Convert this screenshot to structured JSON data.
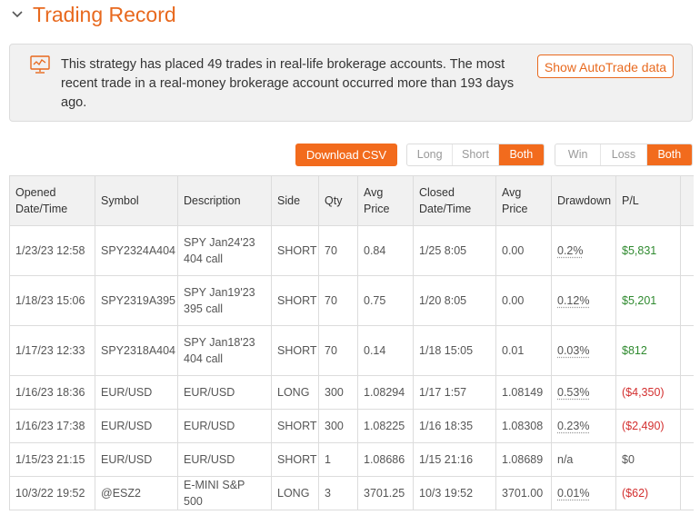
{
  "section": {
    "title": "Trading Record"
  },
  "notice": {
    "icon": "chart-monitor-icon",
    "text": "This strategy has placed 49 trades in real-life brokerage accounts. The most recent trade in a real-money brokerage account occurred more than 193 days ago.",
    "button_label": "Show AutoTrade data"
  },
  "toolbar": {
    "csv_label": "Download CSV",
    "direction_options": [
      "Long",
      "Short",
      "Both"
    ],
    "direction_selected": "Both",
    "outcome_options": [
      "Win",
      "Loss",
      "Both"
    ],
    "outcome_selected": "Both"
  },
  "table": {
    "headers": [
      "Opened\nDate/Time",
      "Symbol",
      "Description",
      "Side",
      "Qty",
      "Avg\nPrice",
      "Closed\nDate/Time",
      "Avg\nPrice",
      "Drawdown",
      "P/L"
    ],
    "rows": [
      {
        "opened": "1/23/23 12:58",
        "symbol": "SPY2324A404",
        "description": "SPY Jan24'23 404 call",
        "side": "SHORT",
        "qty": "70",
        "avg_open": "0.84",
        "closed": "1/25 8:05",
        "avg_close": "0.00",
        "drawdown": "0.2%",
        "pl": "$5,831",
        "pl_sign": "pos"
      },
      {
        "opened": "1/18/23 15:06",
        "symbol": "SPY2319A395",
        "description": "SPY Jan19'23 395 call",
        "side": "SHORT",
        "qty": "70",
        "avg_open": "0.75",
        "closed": "1/20 8:05",
        "avg_close": "0.00",
        "drawdown": "0.12%",
        "pl": "$5,201",
        "pl_sign": "pos"
      },
      {
        "opened": "1/17/23 12:33",
        "symbol": "SPY2318A404",
        "description": "SPY Jan18'23 404 call",
        "side": "SHORT",
        "qty": "70",
        "avg_open": "0.14",
        "closed": "1/18 15:05",
        "avg_close": "0.01",
        "drawdown": "0.03%",
        "pl": "$812",
        "pl_sign": "pos"
      },
      {
        "opened": "1/16/23 18:36",
        "symbol": "EUR/USD",
        "description": "EUR/USD",
        "side": "LONG",
        "qty": "300",
        "avg_open": "1.08294",
        "closed": "1/17 1:57",
        "avg_close": "1.08149",
        "drawdown": "0.53%",
        "pl": "($4,350)",
        "pl_sign": "neg"
      },
      {
        "opened": "1/16/23 17:38",
        "symbol": "EUR/USD",
        "description": "EUR/USD",
        "side": "SHORT",
        "qty": "300",
        "avg_open": "1.08225",
        "closed": "1/16 18:35",
        "avg_close": "1.08308",
        "drawdown": "0.23%",
        "pl": "($2,490)",
        "pl_sign": "neg"
      },
      {
        "opened": "1/15/23 21:15",
        "symbol": "EUR/USD",
        "description": "EUR/USD",
        "side": "SHORT",
        "qty": "1",
        "avg_open": "1.08686",
        "closed": "1/15 21:16",
        "avg_close": "1.08689",
        "drawdown": "n/a",
        "pl": "$0",
        "pl_sign": "zero"
      },
      {
        "opened": "10/3/22 19:52",
        "symbol": "@ESZ2",
        "description": "E-MINI S&P 500",
        "side": "LONG",
        "qty": "3",
        "avg_open": "3701.25",
        "closed": "10/3 19:52",
        "avg_close": "3701.00",
        "drawdown": "0.01%",
        "pl": "($62)",
        "pl_sign": "neg"
      }
    ]
  },
  "colors": {
    "accent": "#f26b1d",
    "positive": "#2f8a2f",
    "negative": "#d32f2f"
  }
}
